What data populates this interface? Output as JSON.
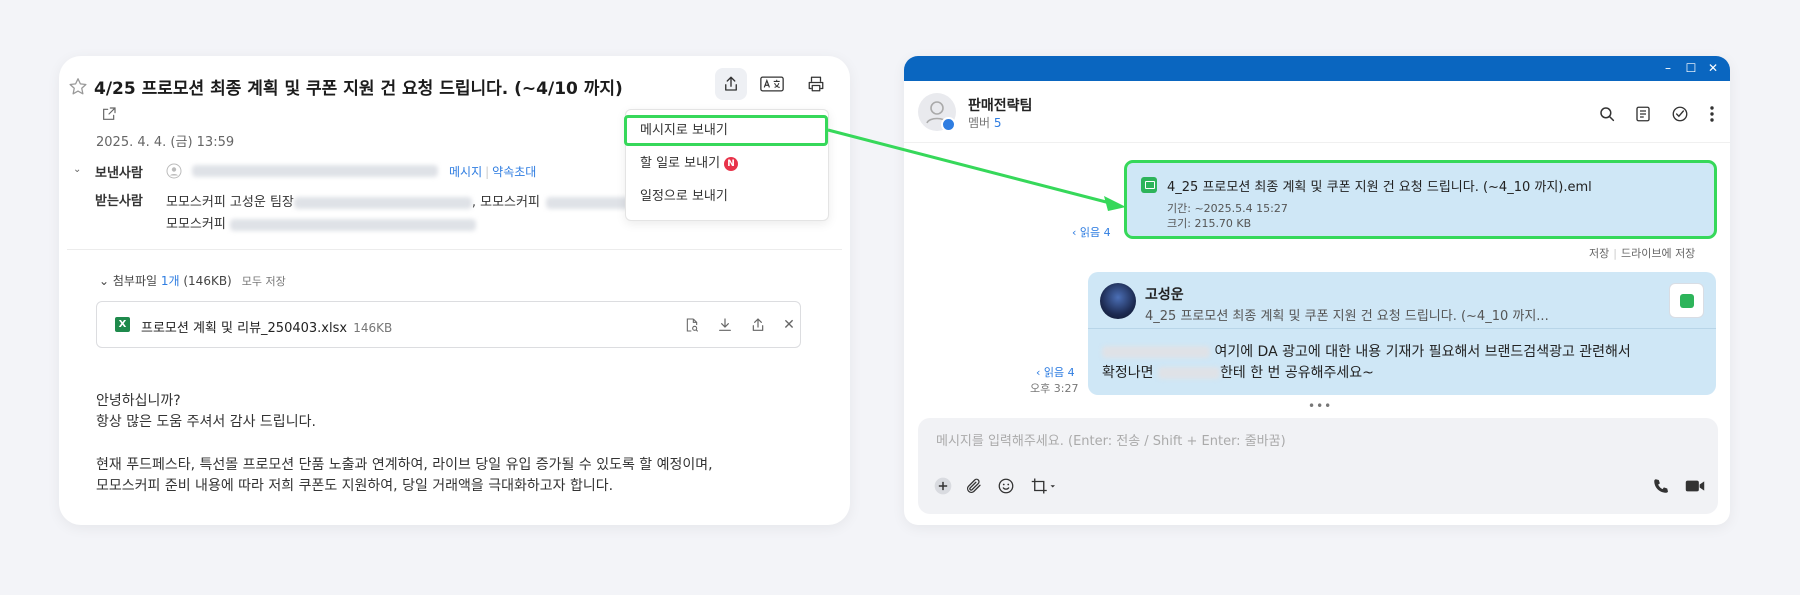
{
  "mail": {
    "subject": "4/25 프로모션 최종 계획 및 쿠폰 지원 건 요청 드립니다. (~4/10 까지)",
    "date": "2025. 4. 4. (금) 13:59",
    "from_label": "보낸사람",
    "to_label": "받는사람",
    "from_link_message": "메시지",
    "from_link_invite": "약속초대",
    "to_line1_a": "모모스커피 고성운 팀장",
    "to_line1_b": ", 모모스커피",
    "to_line2": "모모스커피",
    "attach_prefix": "첨부파일 ",
    "attach_count": "1개",
    "attach_size": " (146KB)",
    "attach_saveall": "모두 저장",
    "attach_file_name": "프로모션 계획 및 리뷰_250403.xlsx",
    "attach_file_size": "146KB",
    "body_line1": "안녕하십니까?",
    "body_line2": "항상 많은 도움 주셔서 감사 드립니다.",
    "body_line3": "현재 푸드페스타, 특선몰 프로모션 단품 노출과 연계하여, 라이브 당일 유입 증가될 수 있도록 할 예정이며,",
    "body_line4": "모모스커피 준비 내용에 따라 저희 쿠폰도 지원하여, 당일 거래액을 극대화하고자 합니다."
  },
  "dropdown": {
    "item1": "메시지로 보내기",
    "item2": "할 일로 보내기",
    "item2_badge": "N",
    "item3": "일정으로 보내기"
  },
  "messenger": {
    "room_name": "판매전략팀",
    "member_label": "멤버 ",
    "member_count": "5",
    "file_name": "4_25 프로모션 최종 계획 및 쿠폰 지원 건 요청 드립니다. (~4_10 까지).eml",
    "file_period": "기간: ~2025.5.4 15:27",
    "file_size": "크기: 215.70 KB",
    "read1": "‹ 읽음 4",
    "save_link": "저장",
    "drive_link": "드라이브에 저장",
    "sender": "고성운",
    "msg_subject": "4_25 프로모션 최종 계획 및 쿠폰 지원 건 요청 드립니다. (~4_10 까지...",
    "msg_line1": " 여기에 DA 광고에 대한 내용 기재가 필요해서 브랜드검색광고 관련해서",
    "msg_line2_a": "확정나면 ",
    "msg_line2_b": "한테 한 번 공유해주세요~",
    "read2": "‹ 읽음 4",
    "time2": "오후 3:27",
    "more": "•••",
    "composer_placeholder": "메시지를 입력해주세요. (Enter: 전송 / Shift + Enter: 줄바꿈)"
  },
  "colors": {
    "accent": "#2f7de1",
    "highlight": "#36d85a",
    "titlebar": "#0a66c0",
    "bubble": "#cfe7f6"
  }
}
